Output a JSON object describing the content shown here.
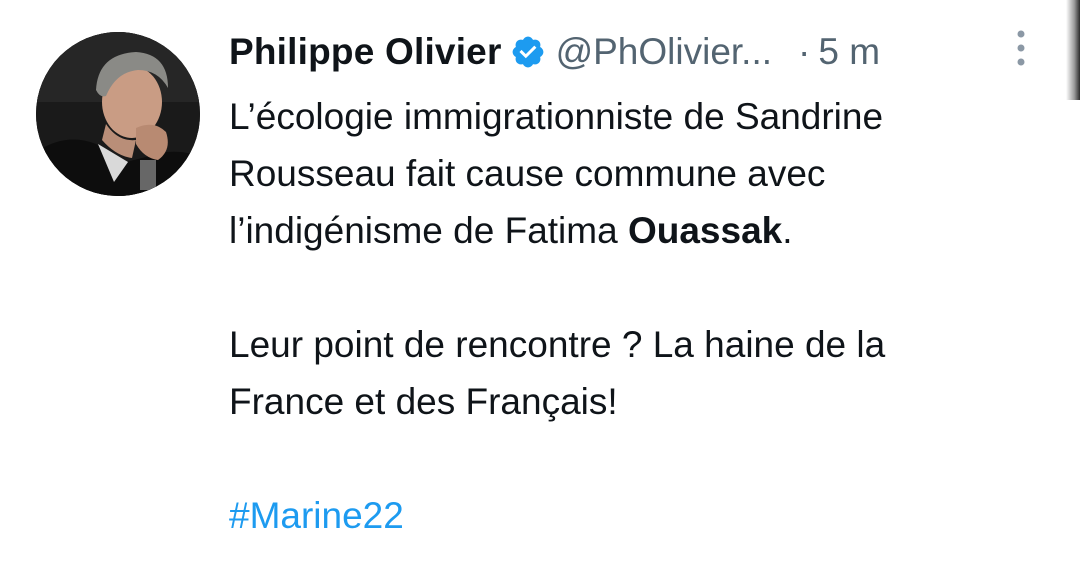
{
  "tweet": {
    "author": {
      "display_name": "Philippe Olivier",
      "verified_icon": "verified-badge-icon",
      "handle": "@PhOlivier...",
      "separator": "·",
      "time": "5 m",
      "avatar_icon": "profile-photo"
    },
    "more_icon": "vertical-ellipsis-icon",
    "text": {
      "line1": "L’écologie immigrationniste de Sandrine",
      "line2": "Rousseau fait cause commune avec",
      "line3_prefix": "l’indigénisme de Fatima ",
      "line3_bold": "Ouassak",
      "line3_suffix": ".",
      "line4": "Leur point de rencontre ? La haine de la",
      "line5": "France et des Français!",
      "hashtag": "#Marine22"
    },
    "colors": {
      "text": "#0f1419",
      "secondary": "#536471",
      "link": "#1d9bf0",
      "verified": "#1d9bf0"
    }
  }
}
